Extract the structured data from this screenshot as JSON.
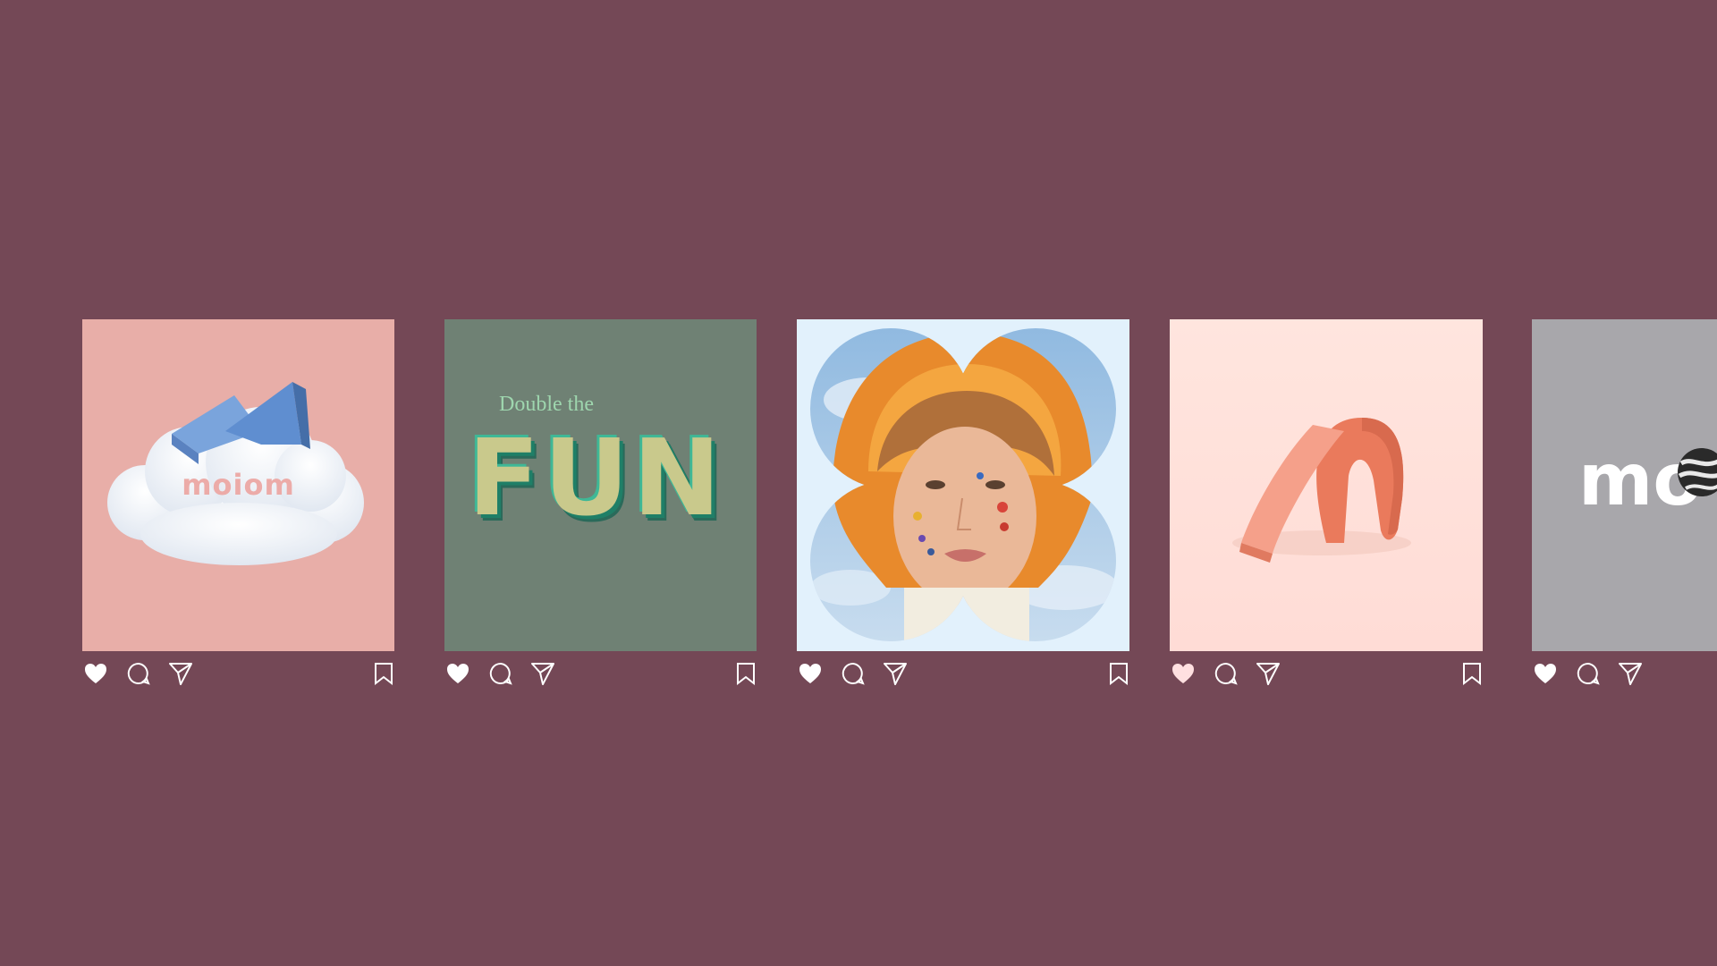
{
  "colors": {
    "background": "#744856",
    "icon": "#ffffff",
    "heart_tint_post4": "#ffe0e0"
  },
  "posts": [
    {
      "image_text": "moiom",
      "actions": [
        "heart-icon",
        "comment-icon",
        "send-icon",
        "bookmark-icon"
      ]
    },
    {
      "image_caption_small": "Double the",
      "image_caption_big": "FUN",
      "actions": [
        "heart-icon",
        "comment-icon",
        "send-icon",
        "bookmark-icon"
      ]
    },
    {
      "actions": [
        "heart-icon",
        "comment-icon",
        "send-icon",
        "bookmark-icon"
      ]
    },
    {
      "actions": [
        "heart-icon",
        "comment-icon",
        "send-icon",
        "bookmark-icon"
      ]
    },
    {
      "image_text": "mo",
      "actions": [
        "heart-icon",
        "comment-icon",
        "send-icon"
      ]
    }
  ]
}
